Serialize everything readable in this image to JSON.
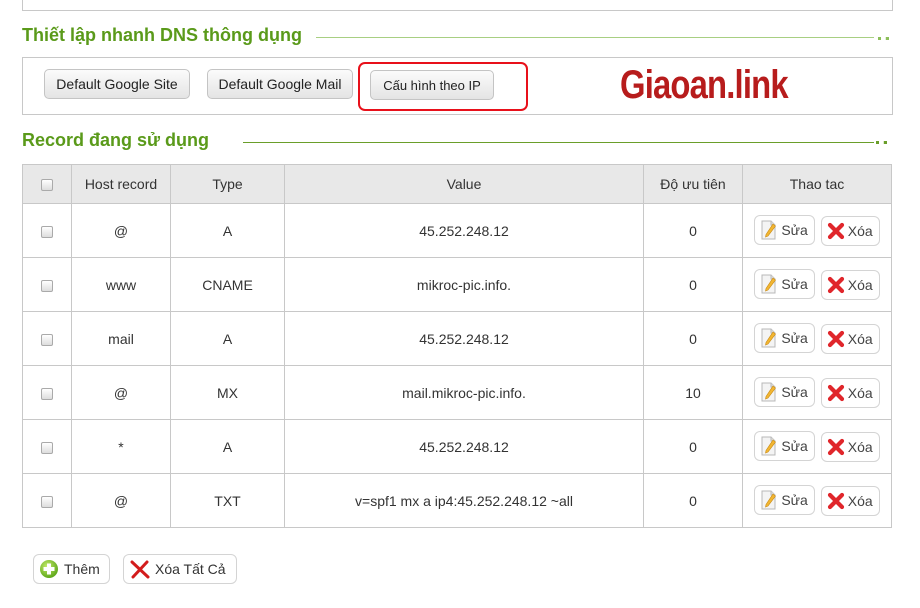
{
  "sections": {
    "quick_setup_title": "Thiết lập nhanh DNS thông dụng",
    "records_title": "Record đang sử dụng"
  },
  "quick_buttons": [
    {
      "label": "Default Google Site"
    },
    {
      "label": "Default Google Mail"
    },
    {
      "label": "Cấu hình theo IP"
    }
  ],
  "watermark": "Giaoan.link",
  "table": {
    "headers": [
      "",
      "Host record",
      "Type",
      "Value",
      "Độ ưu tiên",
      "Thao tac"
    ],
    "rows": [
      {
        "host": "@",
        "type": "A",
        "value": "45.252.248.12",
        "priority": "0"
      },
      {
        "host": "www",
        "type": "CNAME",
        "value": "mikroc-pic.info.",
        "priority": "0"
      },
      {
        "host": "mail",
        "type": "A",
        "value": "45.252.248.12",
        "priority": "0"
      },
      {
        "host": "@",
        "type": "MX",
        "value": "mail.mikroc-pic.info.",
        "priority": "10"
      },
      {
        "host": "*",
        "type": "A",
        "value": "45.252.248.12",
        "priority": "0"
      },
      {
        "host": "@",
        "type": "TXT",
        "value": "v=spf1 mx a ip4:45.252.248.12 ~all",
        "priority": "0"
      }
    ],
    "edit_label": "Sửa",
    "delete_label": "Xóa"
  },
  "footer": {
    "add_label": "Thêm",
    "delete_all_label": "Xóa Tất Cả"
  },
  "colors": {
    "section_title": "#5a9a1a",
    "highlight_border": "#e8101a",
    "watermark": "#b71c1c"
  }
}
